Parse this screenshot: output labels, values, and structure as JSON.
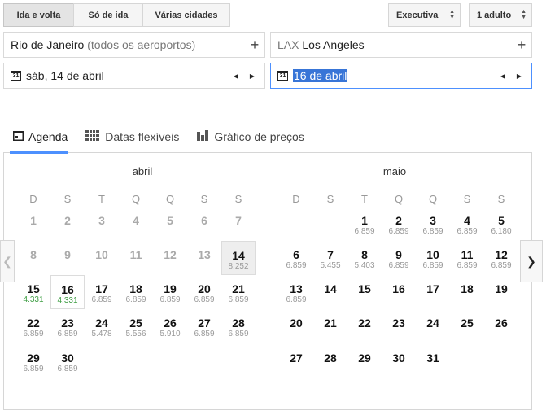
{
  "trip_types": [
    "Ida e volta",
    "Só de ida",
    "Várias cidades"
  ],
  "cabin": "Executiva",
  "passengers": "1 adulto",
  "origin": {
    "main": "Rio de Janeiro",
    "sub": "(todos os aeroportos)"
  },
  "destination": {
    "code": "LAX",
    "city": "Los Angeles"
  },
  "depart_date": "sáb, 14 de abril",
  "return_date": "16 de abril",
  "calendar_icon_text": "31",
  "tabs": [
    "Agenda",
    "Datas flexíveis",
    "Gráfico de preços"
  ],
  "weekdays": [
    "D",
    "S",
    "T",
    "Q",
    "Q",
    "S",
    "S"
  ],
  "months": [
    {
      "name": "abril",
      "days": [
        {
          "d": "1",
          "p": ""
        },
        {
          "d": "2",
          "p": ""
        },
        {
          "d": "3",
          "p": ""
        },
        {
          "d": "4",
          "p": ""
        },
        {
          "d": "5",
          "p": ""
        },
        {
          "d": "6",
          "p": ""
        },
        {
          "d": "7",
          "p": ""
        },
        {
          "d": "8",
          "p": ""
        },
        {
          "d": "9",
          "p": ""
        },
        {
          "d": "10",
          "p": ""
        },
        {
          "d": "11",
          "p": ""
        },
        {
          "d": "12",
          "p": ""
        },
        {
          "d": "13",
          "p": ""
        },
        {
          "d": "14",
          "p": "8.252"
        },
        {
          "d": "15",
          "p": "4.331"
        },
        {
          "d": "16",
          "p": "4.331"
        },
        {
          "d": "17",
          "p": "6.859"
        },
        {
          "d": "18",
          "p": "6.859"
        },
        {
          "d": "19",
          "p": "6.859"
        },
        {
          "d": "20",
          "p": "6.859"
        },
        {
          "d": "21",
          "p": "6.859"
        },
        {
          "d": "22",
          "p": "6.859"
        },
        {
          "d": "23",
          "p": "6.859"
        },
        {
          "d": "24",
          "p": "5.478"
        },
        {
          "d": "25",
          "p": "5.556"
        },
        {
          "d": "26",
          "p": "5.910"
        },
        {
          "d": "27",
          "p": "6.859"
        },
        {
          "d": "28",
          "p": "6.859"
        },
        {
          "d": "29",
          "p": "6.859"
        },
        {
          "d": "30",
          "p": "6.859"
        }
      ]
    },
    {
      "name": "maio",
      "days": [
        {
          "d": "1",
          "p": "6.859"
        },
        {
          "d": "2",
          "p": "6.859"
        },
        {
          "d": "3",
          "p": "6.859"
        },
        {
          "d": "4",
          "p": "6.859"
        },
        {
          "d": "5",
          "p": "6.180"
        },
        {
          "d": "6",
          "p": "6.859"
        },
        {
          "d": "7",
          "p": "5.455"
        },
        {
          "d": "8",
          "p": "5.403"
        },
        {
          "d": "9",
          "p": "6.859"
        },
        {
          "d": "10",
          "p": "6.859"
        },
        {
          "d": "11",
          "p": "6.859"
        },
        {
          "d": "12",
          "p": "6.859"
        },
        {
          "d": "13",
          "p": "6.859"
        },
        {
          "d": "14",
          "p": ""
        },
        {
          "d": "15",
          "p": ""
        },
        {
          "d": "16",
          "p": ""
        },
        {
          "d": "17",
          "p": ""
        },
        {
          "d": "18",
          "p": ""
        },
        {
          "d": "19",
          "p": ""
        },
        {
          "d": "20",
          "p": ""
        },
        {
          "d": "21",
          "p": ""
        },
        {
          "d": "22",
          "p": ""
        },
        {
          "d": "23",
          "p": ""
        },
        {
          "d": "24",
          "p": ""
        },
        {
          "d": "25",
          "p": ""
        },
        {
          "d": "26",
          "p": ""
        },
        {
          "d": "27",
          "p": ""
        },
        {
          "d": "28",
          "p": ""
        },
        {
          "d": "29",
          "p": ""
        },
        {
          "d": "30",
          "p": ""
        },
        {
          "d": "31",
          "p": ""
        }
      ]
    }
  ],
  "colors": {
    "accent": "#4d90fe",
    "cheap_price": "#3f9e44",
    "selection": "#3875d7"
  }
}
